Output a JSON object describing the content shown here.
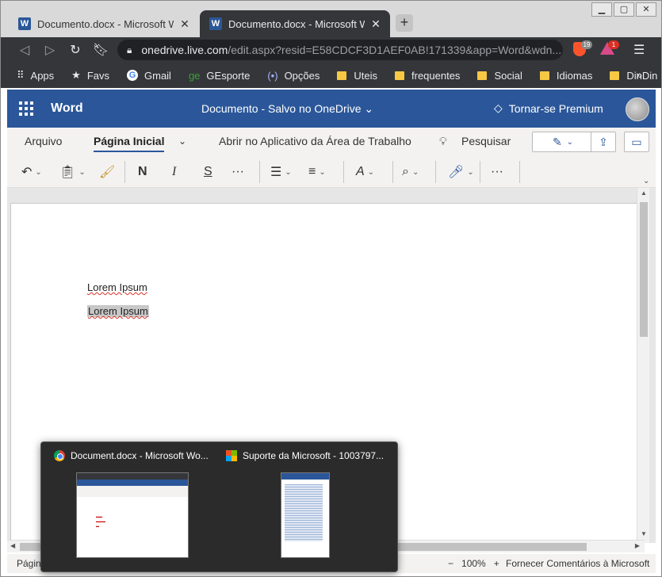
{
  "browser": {
    "tabs": [
      {
        "title": "Documento.docx - Microsoft Word",
        "icon": "word-icon",
        "active": false
      },
      {
        "title": "Documento.docx - Microsoft Word",
        "icon": "word-icon",
        "active": true
      }
    ],
    "new_tab": "+",
    "window_controls": {
      "minimize": "▁",
      "maximize": "▢",
      "close": "✕"
    },
    "address": {
      "host": "onedrive.live.com",
      "path": "/edit.aspx?resid=E58CDCF3D1AEF0AB!171339&app=Word&wdn..."
    },
    "extensions": [
      {
        "name": "brave-shield-icon",
        "badge": "19"
      },
      {
        "name": "alert-extension-icon",
        "badge": "1"
      }
    ],
    "bookmarks": [
      {
        "label": "Apps",
        "icon": "apps-grid-icon"
      },
      {
        "label": "Favs",
        "icon": "star-icon"
      },
      {
        "label": "Gmail",
        "icon": "google-icon"
      },
      {
        "label": "GEsporte",
        "icon": "ge-icon"
      },
      {
        "label": "Opções",
        "icon": "options-icon"
      },
      {
        "label": "Uteis",
        "icon": "folder-icon"
      },
      {
        "label": "frequentes",
        "icon": "folder-icon"
      },
      {
        "label": "Social",
        "icon": "folder-icon"
      },
      {
        "label": "Idiomas",
        "icon": "folder-icon"
      },
      {
        "label": "DinDin",
        "icon": "folder-icon"
      }
    ],
    "bookmarks_more": "»"
  },
  "office": {
    "app_name": "Word",
    "doc_title": "Documento  -  Salvo no OneDrive ⌄",
    "premium": "Tornar-se Premium",
    "accent": "#2b579a"
  },
  "ribbon": {
    "tabs": [
      "Arquivo",
      "Página Inicial",
      "Abrir no Aplicativo da Área de Trabalho",
      "Pesquisar"
    ],
    "more_tabs": "⌄",
    "toolbar": {
      "bold": "N",
      "italic": "I",
      "strike": "S",
      "more1": "···",
      "more2": "···"
    }
  },
  "document": {
    "paragraphs": [
      "Lorem Ipsum",
      "Lorem Ipsum"
    ]
  },
  "status": {
    "page": "Págin",
    "zoom_minus": "−",
    "zoom": "100%",
    "zoom_plus": "+",
    "feedback": "Fornecer Comentários à Microsoft"
  },
  "taskbar_preview": {
    "items": [
      {
        "title": "Document.docx - Microsoft Wo...",
        "icon": "chrome-icon"
      },
      {
        "title": "Suporte da Microsoft - 1003797...",
        "icon": "microsoft-icon"
      }
    ]
  }
}
